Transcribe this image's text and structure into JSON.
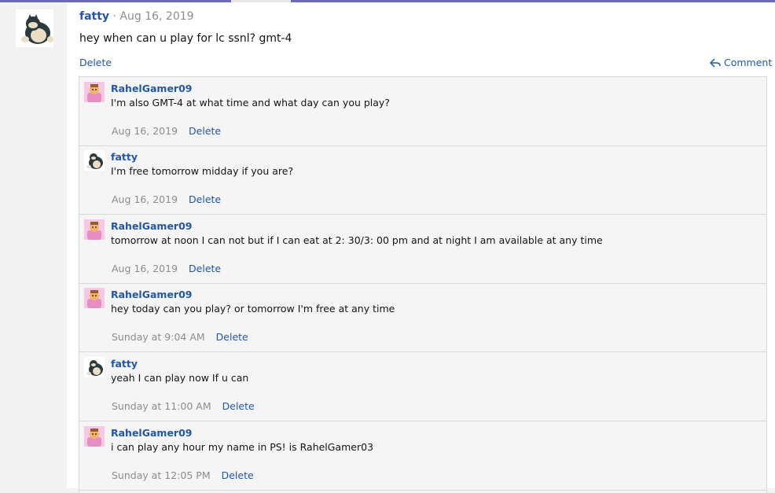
{
  "post": {
    "username": "fatty",
    "separator": "·",
    "date": "Aug 16, 2019",
    "message": "hey when can u play for lc ssnl? gmt-4",
    "delete_label": "Delete",
    "comment_label": "Comment",
    "avatar_icon": "snorlax-avatar-icon"
  },
  "replies": [
    {
      "username": "RahelGamer09",
      "message": "I'm also GMT-4 at what time and what day can you play?",
      "date": "Aug 16, 2019",
      "delete_label": "Delete",
      "avatar_icon": "pink-character-avatar-icon"
    },
    {
      "username": "fatty",
      "message": "I'm free tomorrow midday if you are?",
      "date": "Aug 16, 2019",
      "delete_label": "Delete",
      "avatar_icon": "snorlax-avatar-icon"
    },
    {
      "username": "RahelGamer09",
      "message": "tomorrow at noon I can not but if I can eat at 2: 30/3: 00 pm and at night I am available at any time",
      "date": "Aug 16, 2019",
      "delete_label": "Delete",
      "avatar_icon": "pink-character-avatar-icon"
    },
    {
      "username": "RahelGamer09",
      "message": "hey today can you play? or tomorrow I'm free at any time",
      "date": "Sunday at 9:04 AM",
      "delete_label": "Delete",
      "avatar_icon": "pink-character-avatar-icon"
    },
    {
      "username": "fatty",
      "message": "yeah I can play now If u can",
      "date": "Sunday at 11:00 AM",
      "delete_label": "Delete",
      "avatar_icon": "snorlax-avatar-icon"
    },
    {
      "username": "RahelGamer09",
      "message": "i can play any hour my name in PS! is RahelGamer03",
      "date": "Sunday at 12:05 PM",
      "delete_label": "Delete",
      "avatar_icon": "pink-character-avatar-icon"
    }
  ],
  "colors": {
    "link": "#2356a8",
    "muted": "#8c8c8c",
    "top_strip": "#6b6bb3",
    "reply_bg": "#f5f5f5",
    "border": "#d8d8d8"
  }
}
